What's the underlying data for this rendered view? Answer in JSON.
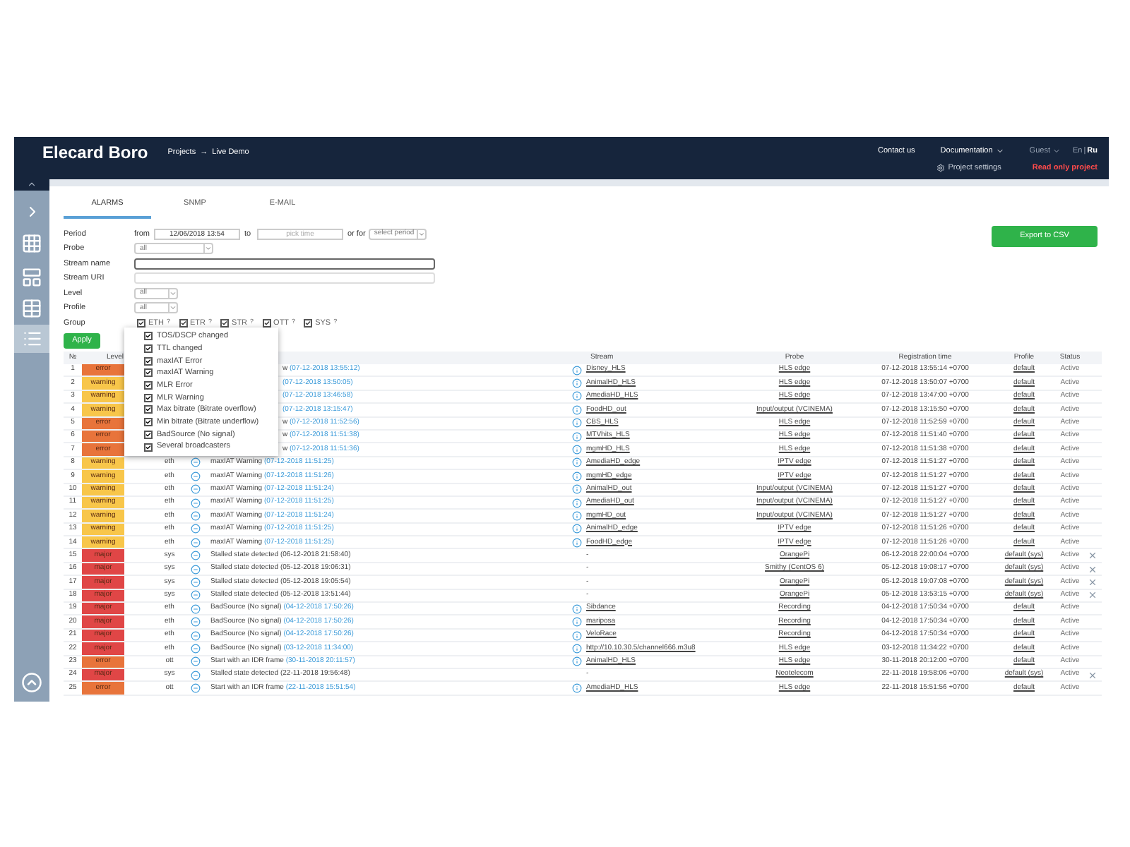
{
  "header": {
    "logo": "Elecard Boro",
    "breadcrumbs": [
      "Projects",
      "Live Demo"
    ],
    "breadcrumb_separator": "→",
    "links": [
      "Contact us",
      "Documentation",
      "Guest"
    ],
    "languages": [
      {
        "label": "En",
        "selected": false
      },
      {
        "label": "Ru",
        "selected": true
      }
    ],
    "language_separator": "|",
    "project_settings": "Project settings",
    "read_only": "Read only project"
  },
  "tabs": [
    {
      "label": "ALARMS",
      "selected": true
    },
    {
      "label": "SNMP",
      "selected": false
    },
    {
      "label": "E-MAIL",
      "selected": false
    }
  ],
  "export_button": "Export to CSV",
  "period": {
    "label": "Period",
    "from_label": "from",
    "from_value": "12/06/2018 13:54",
    "to_label": "to",
    "to_placeholder": "pick time",
    "or_for_label": "or for",
    "select": "select period"
  },
  "filters": [
    {
      "label": "Probe",
      "kind": "wide_select",
      "value": "all"
    },
    {
      "label": "Stream name",
      "kind": "text",
      "focused": true
    },
    {
      "label": "Stream URI",
      "kind": "text",
      "focused": false
    },
    {
      "label": "Level",
      "kind": "select",
      "value": "all"
    },
    {
      "label": "Profile",
      "kind": "select",
      "value": "all"
    }
  ],
  "group": {
    "label": "Group",
    "options": [
      {
        "label": "ETH",
        "hint": "?",
        "checked": true
      },
      {
        "label": "ETR",
        "hint": "?",
        "checked": true
      },
      {
        "label": "STR",
        "hint": "?",
        "checked": true
      },
      {
        "label": "OTT",
        "hint": "?",
        "checked": true
      },
      {
        "label": "SYS",
        "hint": "?",
        "checked": true
      }
    ]
  },
  "apply_button": "Apply",
  "dropdown": [
    {
      "label": "TOS/DSCP changed",
      "checked": true
    },
    {
      "label": "TTL changed",
      "checked": true
    },
    {
      "label": "maxIAT Error",
      "checked": true
    },
    {
      "label": "maxIAT Warning",
      "checked": true
    },
    {
      "label": "MLR Error",
      "checked": true
    },
    {
      "label": "MLR Warning",
      "checked": true
    },
    {
      "label": "Max bitrate (Bitrate overflow)",
      "checked": true
    },
    {
      "label": "Min bitrate (Bitrate underflow)",
      "checked": true
    },
    {
      "label": "BadSource (No signal)",
      "checked": true
    },
    {
      "label": "Several broadcasters",
      "checked": true
    }
  ],
  "table": {
    "columns": [
      "№",
      "Level",
      "Stream",
      "Probe",
      "Registration time",
      "Profile",
      "Status"
    ],
    "rows": [
      {
        "n": "1",
        "level": "error",
        "color": "#e8743b",
        "message": "w",
        "time": "(07-12-2018 13:55:12)",
        "time_linked": true,
        "info_icon": true,
        "stream": "Disney_HLS",
        "probe": "HLS edge",
        "registered": "07-12-2018 13:55:14 +0700",
        "profile": "default",
        "removable": false,
        "status": "Active"
      },
      {
        "n": "2",
        "level": "warning",
        "color": "#f8c64a",
        "time": "(07-12-2018 13:50:05)",
        "time_linked": true,
        "info_icon": true,
        "stream": "AnimalHD_HLS",
        "probe": "HLS edge",
        "registered": "07-12-2018 13:50:07 +0700",
        "profile": "default",
        "removable": false,
        "status": "Active"
      },
      {
        "n": "3",
        "level": "warning",
        "color": "#f8c64a",
        "time": "(07-12-2018 13:46:58)",
        "time_linked": true,
        "info_icon": true,
        "stream": "AmediaHD_HLS",
        "probe": "HLS edge",
        "registered": "07-12-2018 13:47:00 +0700",
        "profile": "default",
        "removable": false,
        "status": "Active"
      },
      {
        "n": "4",
        "level": "warning",
        "color": "#f8c64a",
        "time": "(07-12-2018 13:15:47)",
        "time_linked": true,
        "info_icon": true,
        "stream": "FoodHD_out",
        "probe": "Input/output (VCINEMA)",
        "registered": "07-12-2018 13:15:50 +0700",
        "profile": "default",
        "removable": false,
        "status": "Active"
      },
      {
        "n": "5",
        "level": "error",
        "color": "#e8743b",
        "message": "w",
        "time": "(07-12-2018 11:52:56)",
        "time_linked": true,
        "info_icon": true,
        "stream": "CBS_HLS",
        "probe": "HLS edge",
        "registered": "07-12-2018 11:52:59 +0700",
        "profile": "default",
        "removable": false,
        "status": "Active"
      },
      {
        "n": "6",
        "level": "error",
        "color": "#e8743b",
        "message": "w",
        "time": "(07-12-2018 11:51:38)",
        "time_linked": true,
        "info_icon": true,
        "stream": "MTVhits_HLS",
        "probe": "HLS edge",
        "registered": "07-12-2018 11:51:40 +0700",
        "profile": "default",
        "removable": false,
        "status": "Active"
      },
      {
        "n": "7",
        "level": "error",
        "color": "#e8743b",
        "message": "w",
        "time": "(07-12-2018 11:51:36)",
        "time_linked": true,
        "info_icon": true,
        "stream": "mgmHD_HLS",
        "probe": "HLS edge",
        "registered": "07-12-2018 11:51:38 +0700",
        "profile": "default",
        "removable": false,
        "status": "Active"
      },
      {
        "n": "8",
        "level": "warning",
        "color": "#f8c64a",
        "group": "eth",
        "message": "maxIAT Warning",
        "time": "(07-12-2018 11:51:25)",
        "time_linked": true,
        "info_icon": true,
        "stream": "AmediaHD_edge",
        "probe": "IPTV edge",
        "registered": "07-12-2018 11:51:27 +0700",
        "profile": "default",
        "removable": false,
        "status": "Active"
      },
      {
        "n": "9",
        "level": "warning",
        "color": "#f8c64a",
        "group": "eth",
        "message": "maxIAT Warning",
        "time": "(07-12-2018 11:51:26)",
        "time_linked": true,
        "info_icon": true,
        "stream": "mgmHD_edge",
        "probe": "IPTV edge",
        "registered": "07-12-2018 11:51:27 +0700",
        "profile": "default",
        "removable": false,
        "status": "Active"
      },
      {
        "n": "10",
        "level": "warning",
        "color": "#f8c64a",
        "group": "eth",
        "message": "maxIAT Warning",
        "time": "(07-12-2018 11:51:24)",
        "time_linked": true,
        "info_icon": true,
        "stream": "AnimalHD_out",
        "probe": "Input/output (VCINEMA)",
        "registered": "07-12-2018 11:51:27 +0700",
        "profile": "default",
        "removable": false,
        "status": "Active"
      },
      {
        "n": "11",
        "level": "warning",
        "color": "#f8c64a",
        "group": "eth",
        "message": "maxIAT Warning",
        "time": "(07-12-2018 11:51:25)",
        "time_linked": true,
        "info_icon": true,
        "stream": "AmediaHD_out",
        "probe": "Input/output (VCINEMA)",
        "registered": "07-12-2018 11:51:27 +0700",
        "profile": "default",
        "removable": false,
        "status": "Active"
      },
      {
        "n": "12",
        "level": "warning",
        "color": "#f8c64a",
        "group": "eth",
        "message": "maxIAT Warning",
        "time": "(07-12-2018 11:51:24)",
        "time_linked": true,
        "info_icon": true,
        "stream": "mgmHD_out",
        "probe": "Input/output (VCINEMA)",
        "registered": "07-12-2018 11:51:27 +0700",
        "profile": "default",
        "removable": false,
        "status": "Active"
      },
      {
        "n": "13",
        "level": "warning",
        "color": "#f8c64a",
        "group": "eth",
        "message": "maxIAT Warning",
        "time": "(07-12-2018 11:51:25)",
        "time_linked": true,
        "info_icon": true,
        "stream": "AnimalHD_edge",
        "probe": "IPTV edge",
        "registered": "07-12-2018 11:51:26 +0700",
        "profile": "default",
        "removable": false,
        "status": "Active"
      },
      {
        "n": "14",
        "level": "warning",
        "color": "#f8c64a",
        "group": "eth",
        "message": "maxIAT Warning",
        "time": "(07-12-2018 11:51:25)",
        "time_linked": true,
        "info_icon": true,
        "stream": "FoodHD_edge",
        "probe": "IPTV edge",
        "registered": "07-12-2018 11:51:26 +0700",
        "profile": "default",
        "removable": false,
        "status": "Active"
      },
      {
        "n": "15",
        "level": "major",
        "color": "#e04646",
        "group": "sys",
        "message": "Stalled state detected",
        "time": "(06-12-2018 21:58:40)",
        "time_linked": false,
        "info_icon": false,
        "stream": "-",
        "probe": "OrangePi",
        "registered": "06-12-2018 22:00:04 +0700",
        "profile": "default (sys)",
        "removable": true,
        "status": "Active"
      },
      {
        "n": "16",
        "level": "major",
        "color": "#e04646",
        "group": "sys",
        "message": "Stalled state detected",
        "time": "(05-12-2018 19:06:31)",
        "time_linked": false,
        "info_icon": false,
        "stream": "-",
        "probe": "Smithy (CentOS 6)",
        "registered": "05-12-2018 19:08:17 +0700",
        "profile": "default (sys)",
        "removable": true,
        "status": "Active"
      },
      {
        "n": "17",
        "level": "major",
        "color": "#e04646",
        "group": "sys",
        "message": "Stalled state detected",
        "time": "(05-12-2018 19:05:54)",
        "time_linked": false,
        "info_icon": false,
        "stream": "-",
        "probe": "OrangePi",
        "registered": "05-12-2018 19:07:08 +0700",
        "profile": "default (sys)",
        "removable": true,
        "status": "Active"
      },
      {
        "n": "18",
        "level": "major",
        "color": "#e04646",
        "group": "sys",
        "message": "Stalled state detected",
        "time": "(05-12-2018 13:51:44)",
        "time_linked": false,
        "info_icon": false,
        "stream": "-",
        "probe": "OrangePi",
        "registered": "05-12-2018 13:53:15 +0700",
        "profile": "default (sys)",
        "removable": true,
        "status": "Active"
      },
      {
        "n": "19",
        "level": "major",
        "color": "#e04646",
        "group": "eth",
        "message": "BadSource (No signal)",
        "time": "(04-12-2018 17:50:26)",
        "time_linked": true,
        "info_icon": true,
        "stream": "Sibdance",
        "probe": "Recording",
        "registered": "04-12-2018 17:50:34 +0700",
        "profile": "default",
        "removable": false,
        "status": "Active"
      },
      {
        "n": "20",
        "level": "major",
        "color": "#e04646",
        "group": "eth",
        "message": "BadSource (No signal)",
        "time": "(04-12-2018 17:50:26)",
        "time_linked": true,
        "info_icon": true,
        "stream": "mariposa",
        "probe": "Recording",
        "registered": "04-12-2018 17:50:34 +0700",
        "profile": "default",
        "removable": false,
        "status": "Active"
      },
      {
        "n": "21",
        "level": "major",
        "color": "#e04646",
        "group": "eth",
        "message": "BadSource (No signal)",
        "time": "(04-12-2018 17:50:26)",
        "time_linked": true,
        "info_icon": true,
        "stream": "VeloRace",
        "probe": "Recording",
        "registered": "04-12-2018 17:50:34 +0700",
        "profile": "default",
        "removable": false,
        "status": "Active"
      },
      {
        "n": "22",
        "level": "major",
        "color": "#e04646",
        "group": "eth",
        "message": "BadSource (No signal)",
        "time": "(03-12-2018 11:34:00)",
        "time_linked": true,
        "info_icon": true,
        "stream": "http://10.10.30.5/channel666.m3u8",
        "probe": "HLS edge",
        "registered": "03-12-2018 11:34:22 +0700",
        "profile": "default",
        "removable": false,
        "status": "Active"
      },
      {
        "n": "23",
        "level": "error",
        "color": "#e8743b",
        "group": "ott",
        "message": "Start with an IDR frame",
        "time": "(30-11-2018 20:11:57)",
        "time_linked": true,
        "info_icon": true,
        "stream": "AnimalHD_HLS",
        "probe": "HLS edge",
        "registered": "30-11-2018 20:12:00 +0700",
        "profile": "default",
        "removable": false,
        "status": "Active"
      },
      {
        "n": "24",
        "level": "major",
        "color": "#e04646",
        "group": "sys",
        "message": "Stalled state detected",
        "time": "(22-11-2018 19:56:48)",
        "time_linked": false,
        "info_icon": false,
        "stream": "-",
        "probe": "Neotelecom",
        "registered": "22-11-2018 19:58:06 +0700",
        "profile": "default (sys)",
        "removable": true,
        "status": "Active"
      },
      {
        "n": "25",
        "level": "error",
        "color": "#e8743b",
        "group": "ott",
        "message": "Start with an IDR frame",
        "time": "(22-11-2018 15:51:54)",
        "time_linked": true,
        "info_icon": true,
        "stream": "AmediaHD_HLS",
        "probe": "HLS edge",
        "registered": "22-11-2018 15:51:56 +0700",
        "profile": "default",
        "removable": false,
        "status": "Active"
      }
    ]
  }
}
